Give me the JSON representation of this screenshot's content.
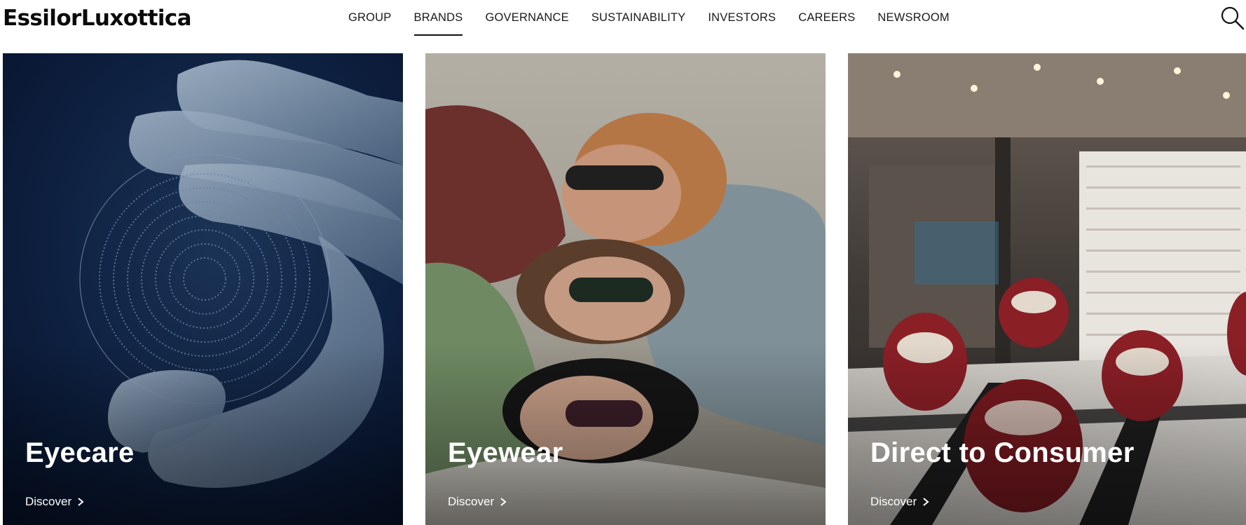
{
  "brand": {
    "logo_text": "EssilorLuxottica"
  },
  "nav": {
    "items": [
      {
        "label": "GROUP",
        "active": false
      },
      {
        "label": "BRANDS",
        "active": true
      },
      {
        "label": "GOVERNANCE",
        "active": false
      },
      {
        "label": "SUSTAINABILITY",
        "active": false
      },
      {
        "label": "INVESTORS",
        "active": false
      },
      {
        "label": "CAREERS",
        "active": false
      },
      {
        "label": "NEWSROOM",
        "active": false
      }
    ],
    "search_icon": "search-icon"
  },
  "cards": [
    {
      "title": "Eyecare",
      "link_label": "Discover",
      "link_icon": "chevron-right-icon"
    },
    {
      "title": "Eyewear",
      "link_label": "Discover",
      "link_icon": "chevron-right-icon"
    },
    {
      "title": "Direct to Consumer",
      "link_label": "Discover",
      "link_icon": "chevron-right-icon"
    }
  ],
  "colors": {
    "text": "#111111",
    "background": "#ffffff",
    "card_text": "#ffffff"
  }
}
